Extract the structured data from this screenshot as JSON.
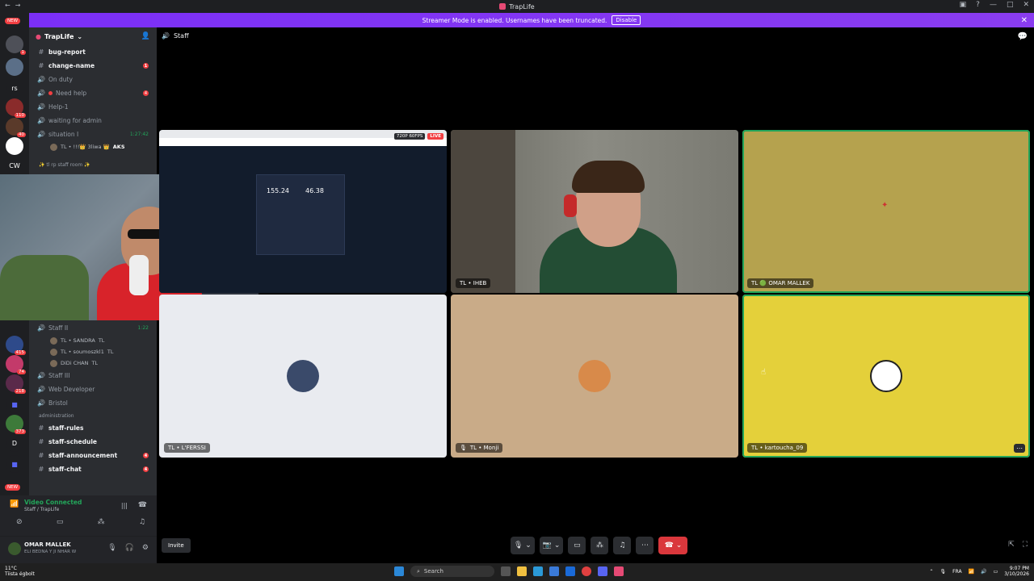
{
  "window": {
    "title": "TrapLife"
  },
  "banner": {
    "text": "Streamer Mode is enabled. Usernames have been truncated.",
    "button": "Disable"
  },
  "guilds": {
    "new_top": "NEW",
    "new_bottom": "NEW",
    "rs": "rs",
    "cw": "CW",
    "d": "D",
    "badges": [
      "1",
      "110",
      "40",
      "415",
      "74",
      "218",
      "373"
    ]
  },
  "sidebar": {
    "server_name": "TrapLife",
    "channels": [
      {
        "label": "bug-report",
        "type": "text"
      },
      {
        "label": "change-name",
        "type": "text",
        "badge": "1"
      },
      {
        "label": "On duty",
        "type": "voice"
      },
      {
        "label": "Need help",
        "type": "voice",
        "badge": "4"
      },
      {
        "label": "Help-1",
        "type": "voice"
      },
      {
        "label": "waiting for admin",
        "type": "voice"
      },
      {
        "label": "situation I",
        "type": "voice",
        "time": "1:27:42"
      }
    ],
    "situation_user": "TL • !!!👑 3liwa 👑",
    "situation_user_tag": "AKS",
    "category_staffroom": "✨ tl rp staff room ✨",
    "staff2": {
      "label": "Staff II",
      "time": "1:22"
    },
    "staff2_users": [
      {
        "name": "TL • SANDRA",
        "tag": "TL"
      },
      {
        "name": "TL • soumoszkl1",
        "tag": "TL"
      },
      {
        "name": "DiDi CHAN",
        "tag": "TL"
      }
    ],
    "staff3": "Staff III",
    "web_dev": "Web Developer",
    "bristol": "Bristol",
    "category_admin": "administration",
    "admin_channels": [
      {
        "label": "staff-rules"
      },
      {
        "label": "staff-schedule"
      },
      {
        "label": "staff-announcement",
        "badge": "4"
      },
      {
        "label": "staff-chat",
        "badge": "4"
      }
    ]
  },
  "voice_panel": {
    "status": "Video Connected",
    "sub": "Staff / TrapLife"
  },
  "user_panel": {
    "name": "OMAR MALLEK",
    "sub": "ELI BEDNA Y JI NHAR W"
  },
  "call": {
    "channel": "Staff",
    "invite": "Invite"
  },
  "tiles": [
    {
      "label": "",
      "badge_quality": "720P 60FPS",
      "badge_live": "LIVE",
      "speed_down": "155.24",
      "speed_up": "46.38"
    },
    {
      "label": "TL • IHEB"
    },
    {
      "label": "TL 🟢 OMAR MALLEK"
    },
    {
      "label": "TL • L'FERSSI"
    },
    {
      "label": "TL • Monji"
    },
    {
      "label": "TL • kartoucha_09"
    }
  ],
  "taskbar": {
    "weather_temp": "11°C",
    "weather_desc": "Tiista égbolt",
    "search": "Search",
    "lang": "FRA",
    "time": "9:07 PM",
    "date": "3/10/2026"
  }
}
